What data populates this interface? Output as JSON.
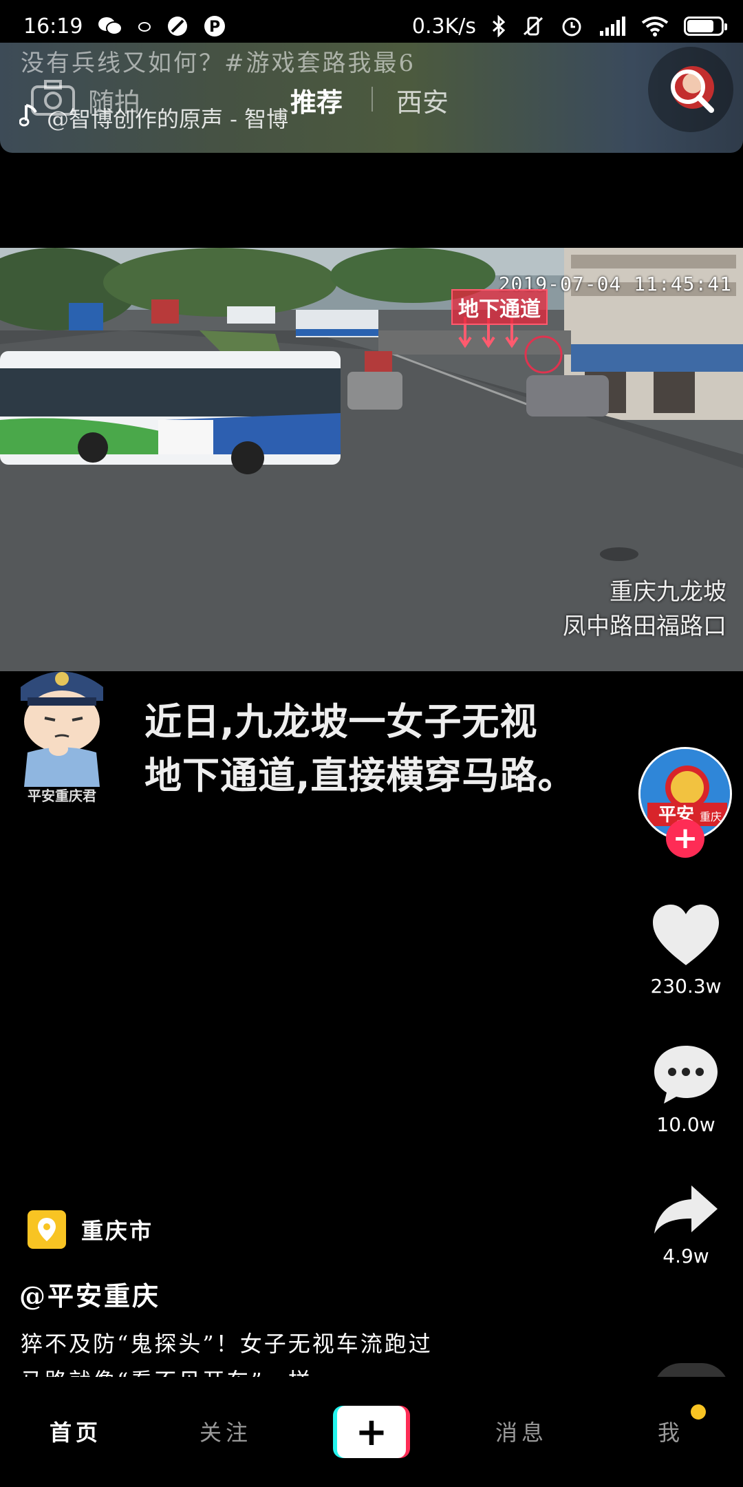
{
  "status_bar": {
    "time": "16:19",
    "network_speed": "0.3K/s",
    "icons": [
      "wechat-icon",
      "weibo-icon",
      "block-icon",
      "p-icon",
      "bluetooth-icon",
      "vibrate-off-icon",
      "alarm-icon",
      "signal-icon",
      "wifi-icon",
      "battery-icon"
    ]
  },
  "header": {
    "ghost_line": "没有兵线又如何？#游戏套路我最6",
    "tabs": [
      "随拍",
      "推荐",
      "西安"
    ],
    "active_tab": "推荐",
    "music": "@智博创作的原声 - 智博"
  },
  "video": {
    "timestamp": "2019-07-04 11:45:41",
    "sign": "地下通道",
    "location_line1": "重庆九龙坡",
    "location_line2": "凤中路田福路口"
  },
  "caption": {
    "line1": "近日,九龙坡一女子无视",
    "line2": "地下通道,直接横穿马路。",
    "officer_label": "平安重庆君"
  },
  "author_avatar_text": "平安",
  "author_avatar_subtext": "重庆",
  "actions": {
    "likes": "230.3w",
    "comments": "10.0w",
    "shares": "4.9w"
  },
  "post": {
    "location": "重庆市",
    "author": "@平安重庆",
    "description": "猝不及防“鬼探头”！女子无视车流跑过",
    "description_cut": "马路就像“看不见开车”一样"
  },
  "bottom_nav": {
    "home": "首页",
    "follow": "关注",
    "create": "+",
    "messages": "消息",
    "me": "我"
  },
  "colors": {
    "accent_red": "#fe2c55",
    "accent_cyan": "#25f4ee",
    "location_yellow": "#f8c423"
  }
}
